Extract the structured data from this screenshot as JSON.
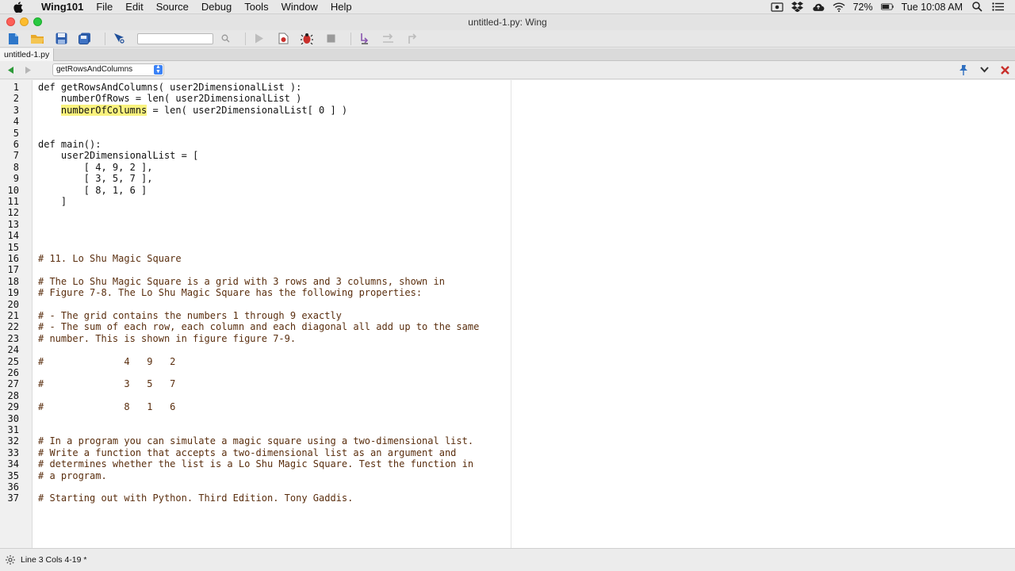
{
  "menubar": {
    "app_name": "Wing101",
    "items": [
      "File",
      "Edit",
      "Source",
      "Debug",
      "Tools",
      "Window",
      "Help"
    ],
    "battery": "72%",
    "clock": "Tue 10:08 AM"
  },
  "window": {
    "title": "untitled-1.py: Wing"
  },
  "tab": {
    "label": "untitled-1.py"
  },
  "navbar": {
    "scope": "getRowsAndColumns"
  },
  "code": {
    "lines": [
      "def getRowsAndColumns( user2DimensionalList ):",
      "    numberOfRows = len( user2DimensionalList )",
      "    numberOfColumns = len( user2DimensionalList[ 0 ] )",
      "",
      "",
      "def main():",
      "    user2DimensionalList = [",
      "        [ 4, 9, 2 ],",
      "        [ 3, 5, 7 ],",
      "        [ 8, 1, 6 ]",
      "    ]",
      "",
      "",
      "",
      "",
      "# 11. Lo Shu Magic Square",
      "",
      "# The Lo Shu Magic Square is a grid with 3 rows and 3 columns, shown in",
      "# Figure 7-8. The Lo Shu Magic Square has the following properties:",
      "",
      "# - The grid contains the numbers 1 through 9 exactly",
      "# - The sum of each row, each column and each diagonal all add up to the same",
      "# number. This is shown in figure figure 7-9.",
      "",
      "#              4   9   2",
      "",
      "#              3   5   7",
      "",
      "#              8   1   6",
      "",
      "",
      "# In a program you can simulate a magic square using a two-dimensional list.",
      "# Write a function that accepts a two-dimensional list as an argument and",
      "# determines whether the list is a Lo Shu Magic Square. Test the function in",
      "# a program.",
      "",
      "# Starting out with Python. Third Edition. Tony Gaddis."
    ]
  },
  "status": {
    "text": "Line 3 Cols 4-19 *"
  }
}
